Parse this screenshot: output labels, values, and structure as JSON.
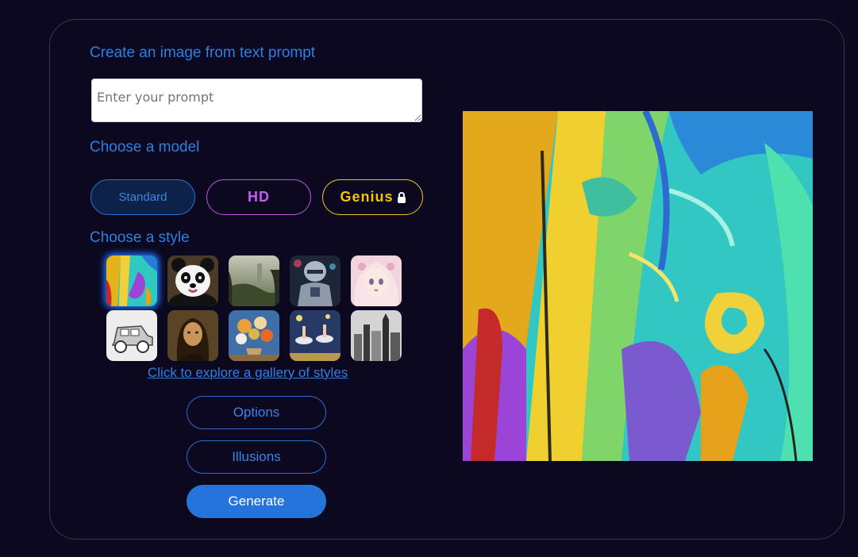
{
  "headings": {
    "create": "Create an image from text prompt",
    "model": "Choose a model",
    "style": "Choose a style"
  },
  "prompt": {
    "placeholder": "Enter your prompt",
    "value": ""
  },
  "models": {
    "standard": "Standard",
    "hd": "HD",
    "genius": "Genius",
    "genius_icon": "lock-icon"
  },
  "styles": {
    "selected_index": 0,
    "items": [
      {
        "name": "abstract-painting",
        "colors": [
          "#2fd6c8",
          "#f0c31a",
          "#9b45d6"
        ]
      },
      {
        "name": "panda-portrait",
        "colors": [
          "#f4f4f4",
          "#111111",
          "#c79a5a"
        ]
      },
      {
        "name": "misty-landscape",
        "colors": [
          "#9aa38f",
          "#4c5a3b",
          "#2b2f22"
        ]
      },
      {
        "name": "robot-armor",
        "colors": [
          "#b9c3cf",
          "#2b3a52",
          "#d94c6a"
        ]
      },
      {
        "name": "anime-girl",
        "colors": [
          "#f6c7cf",
          "#ffe8ec",
          "#c9a2b8"
        ]
      },
      {
        "name": "vintage-car-sketch",
        "colors": [
          "#efefef",
          "#a9a9a9",
          "#555555"
        ]
      },
      {
        "name": "renaissance-portrait",
        "colors": [
          "#6a4a22",
          "#c89a5a",
          "#2a1a0c"
        ]
      },
      {
        "name": "flower-still-life",
        "colors": [
          "#e9a23a",
          "#3e6fa8",
          "#d8d3c1"
        ]
      },
      {
        "name": "dancers-painting",
        "colors": [
          "#2b3d6b",
          "#f0d87a",
          "#e0e0ea"
        ]
      },
      {
        "name": "city-ink-drawing",
        "colors": [
          "#d9d9d9",
          "#7a7a7a",
          "#2e2e2e"
        ]
      }
    ]
  },
  "gallery_link": "Click to explore a gallery of styles",
  "buttons": {
    "options": "Options",
    "illusions": "Illusions",
    "generate": "Generate"
  },
  "colors": {
    "background": "#0b0820",
    "accent_blue": "#2f7fe0",
    "hd_purple": "#c45ef0",
    "genius_gold": "#f2c20e",
    "generate_blue": "#2474dc"
  }
}
